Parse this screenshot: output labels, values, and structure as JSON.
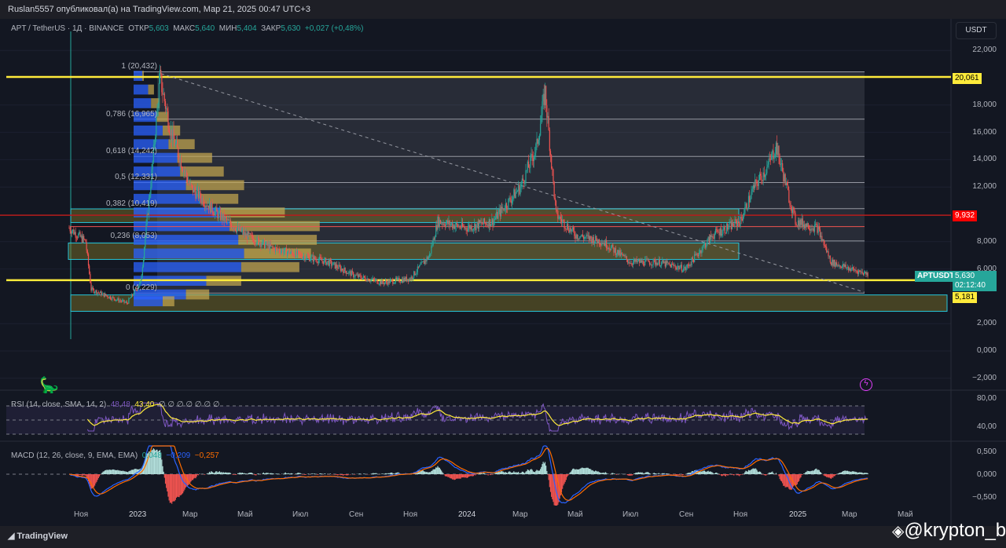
{
  "header": {
    "published": "Ruslan5557 опубликовал(а) на TradingView.com, Мар 21, 2025 00:47 UTC+3"
  },
  "legend": {
    "symbol": "APT / TetherUS · 1Д · BINANCE",
    "open_label": "ОТКР",
    "open": "5,603",
    "high_label": "МАКС",
    "high": "5,640",
    "low_label": "МИН",
    "low": "5,404",
    "close_label": "ЗАКР",
    "close": "5,630",
    "change": "+0,027 (+0,48%)"
  },
  "currency_button": "USDT",
  "price_axis": [
    "22,000",
    "18,000",
    "16,000",
    "14,000",
    "12,000",
    "8,000",
    "6,000",
    "2,000",
    "0,000",
    "−2,000"
  ],
  "price_axis_values": [
    22,
    18,
    16,
    14,
    12,
    8,
    6,
    2,
    0,
    -2
  ],
  "tags": {
    "top_level": "20,061",
    "red_level": "9,932",
    "symbol": "APTUSDT",
    "last": "5,630",
    "countdown": "02:12:40",
    "bottom_level": "5,181"
  },
  "tag_values": {
    "top_level": 20.061,
    "red_level": 9.932,
    "bottom_level": 5.181,
    "last": 5.63
  },
  "fib_levels": [
    {
      "label": "1 (20,432)",
      "price": 20.432
    },
    {
      "label": "0,786 (16,965)",
      "price": 16.965
    },
    {
      "label": "0,618 (14,242)",
      "price": 14.242
    },
    {
      "label": "0,5 (12,331)",
      "price": 12.331
    },
    {
      "label": "0,382 (10,419)",
      "price": 10.419
    },
    {
      "label": "0,236 (8,053)",
      "price": 8.053
    },
    {
      "label": "0 (4,229)",
      "price": 4.229
    }
  ],
  "rsi": {
    "title": "RSI (14, close, SMA, 14, 2)",
    "value": "48,48",
    "sma": "43,40",
    "extras": "∅ ∅ ∅ ∅ ∅ ∅ ∅",
    "axis": [
      "80,00",
      "40,00"
    ]
  },
  "macd": {
    "title": "MACD (12, 26, close, 9, EMA, EMA)",
    "hist": "0,048",
    "macd": "−0,209",
    "signal": "−0,257",
    "axis": [
      "0,500",
      "0,000",
      "−0,500"
    ]
  },
  "time_axis": [
    "Ноя",
    "2023",
    "Мар",
    "Май",
    "Июл",
    "Сен",
    "Ноя",
    "2024",
    "Мар",
    "Май",
    "Июл",
    "Сен",
    "Ноя",
    "2025",
    "Мар",
    "Май"
  ],
  "footer": {
    "brand": "TradingView",
    "watermark": "@krypton_bit"
  },
  "colors": {
    "up": "#26a69a",
    "down": "#ef5350",
    "yellow": "#ffeb3b",
    "red": "#ff0000",
    "rsi": "#7e57c2",
    "macd": "#2962ff",
    "signal": "#ff6d00"
  },
  "chart_data": {
    "type": "candlestick",
    "title": "APT / TetherUS 1D",
    "ylim": [
      -2,
      23
    ],
    "path_months_since_nov2022": [
      -0.4,
      0.2,
      0.4,
      1,
      1.7,
      2.2,
      2.6,
      2.9,
      3.3,
      4,
      5,
      6,
      7,
      8,
      9,
      10,
      11,
      12,
      12.7,
      13,
      14,
      15,
      16,
      16.6,
      16.9,
      17.3,
      18,
      19,
      20,
      21,
      22,
      23,
      24,
      24.5,
      25,
      25.3,
      25.8,
      26,
      26.8,
      27.3,
      28,
      28.65
    ],
    "path_price": [
      9,
      8,
      4.5,
      4,
      3.5,
      5,
      13,
      20,
      16,
      12,
      10,
      8.5,
      7.5,
      7,
      6.5,
      5.5,
      5,
      5.3,
      7,
      9.5,
      9,
      9.5,
      12,
      15,
      19,
      10,
      8.5,
      8,
      6.5,
      6.5,
      6,
      8.5,
      9.5,
      12,
      13.5,
      15,
      11,
      9.5,
      9,
      6.5,
      6,
      5.63
    ]
  }
}
